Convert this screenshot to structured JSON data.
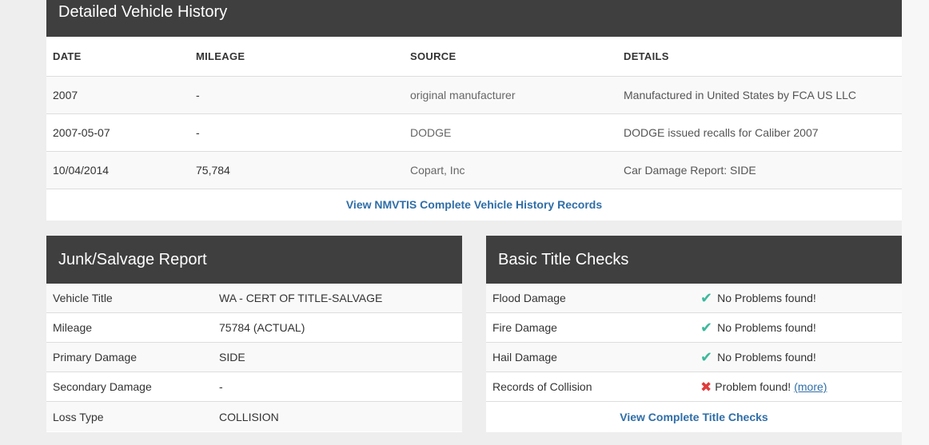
{
  "history": {
    "title": "Detailed Vehicle History",
    "columns": [
      "DATE",
      "MILEAGE",
      "SOURCE",
      "DETAILS"
    ],
    "rows": [
      {
        "date": "2007",
        "mileage": "-",
        "source": "original manufacturer",
        "details": "Manufactured in United States by FCA US LLC"
      },
      {
        "date": "2007-05-07",
        "mileage": "-",
        "source": "DODGE",
        "details": "DODGE issued recalls for Caliber 2007"
      },
      {
        "date": "10/04/2014",
        "mileage": "75,784",
        "source": "Copart, Inc",
        "details": "Car Damage Report: SIDE"
      }
    ],
    "link_label": "View NMVTIS Complete Vehicle History Records"
  },
  "junk": {
    "title": "Junk/Salvage Report",
    "rows": [
      {
        "label": "Vehicle Title",
        "value": "WA - CERT OF TITLE-SALVAGE"
      },
      {
        "label": "Mileage",
        "value": "75784 (ACTUAL)"
      },
      {
        "label": "Primary Damage",
        "value": "SIDE"
      },
      {
        "label": "Secondary Damage",
        "value": "-"
      },
      {
        "label": "Loss Type",
        "value": "COLLISION"
      }
    ]
  },
  "checks": {
    "title": "Basic Title Checks",
    "rows": [
      {
        "label": "Flood Damage",
        "status": "No Problems found!",
        "icon": "check-icon"
      },
      {
        "label": "Fire Damage",
        "status": "No Problems found!",
        "icon": "check-icon"
      },
      {
        "label": "Hail Damage",
        "status": "No Problems found!",
        "icon": "check-icon"
      },
      {
        "label": "Records of Collision",
        "status": "Problem found!",
        "icon": "x-icon",
        "more_label": "(more)"
      }
    ],
    "link_label": "View Complete Title Checks"
  },
  "colors": {
    "header_bg": "#3f3f3f",
    "link": "#2f6ea7",
    "ok": "#3cb99c",
    "problem": "#e03b3b"
  }
}
